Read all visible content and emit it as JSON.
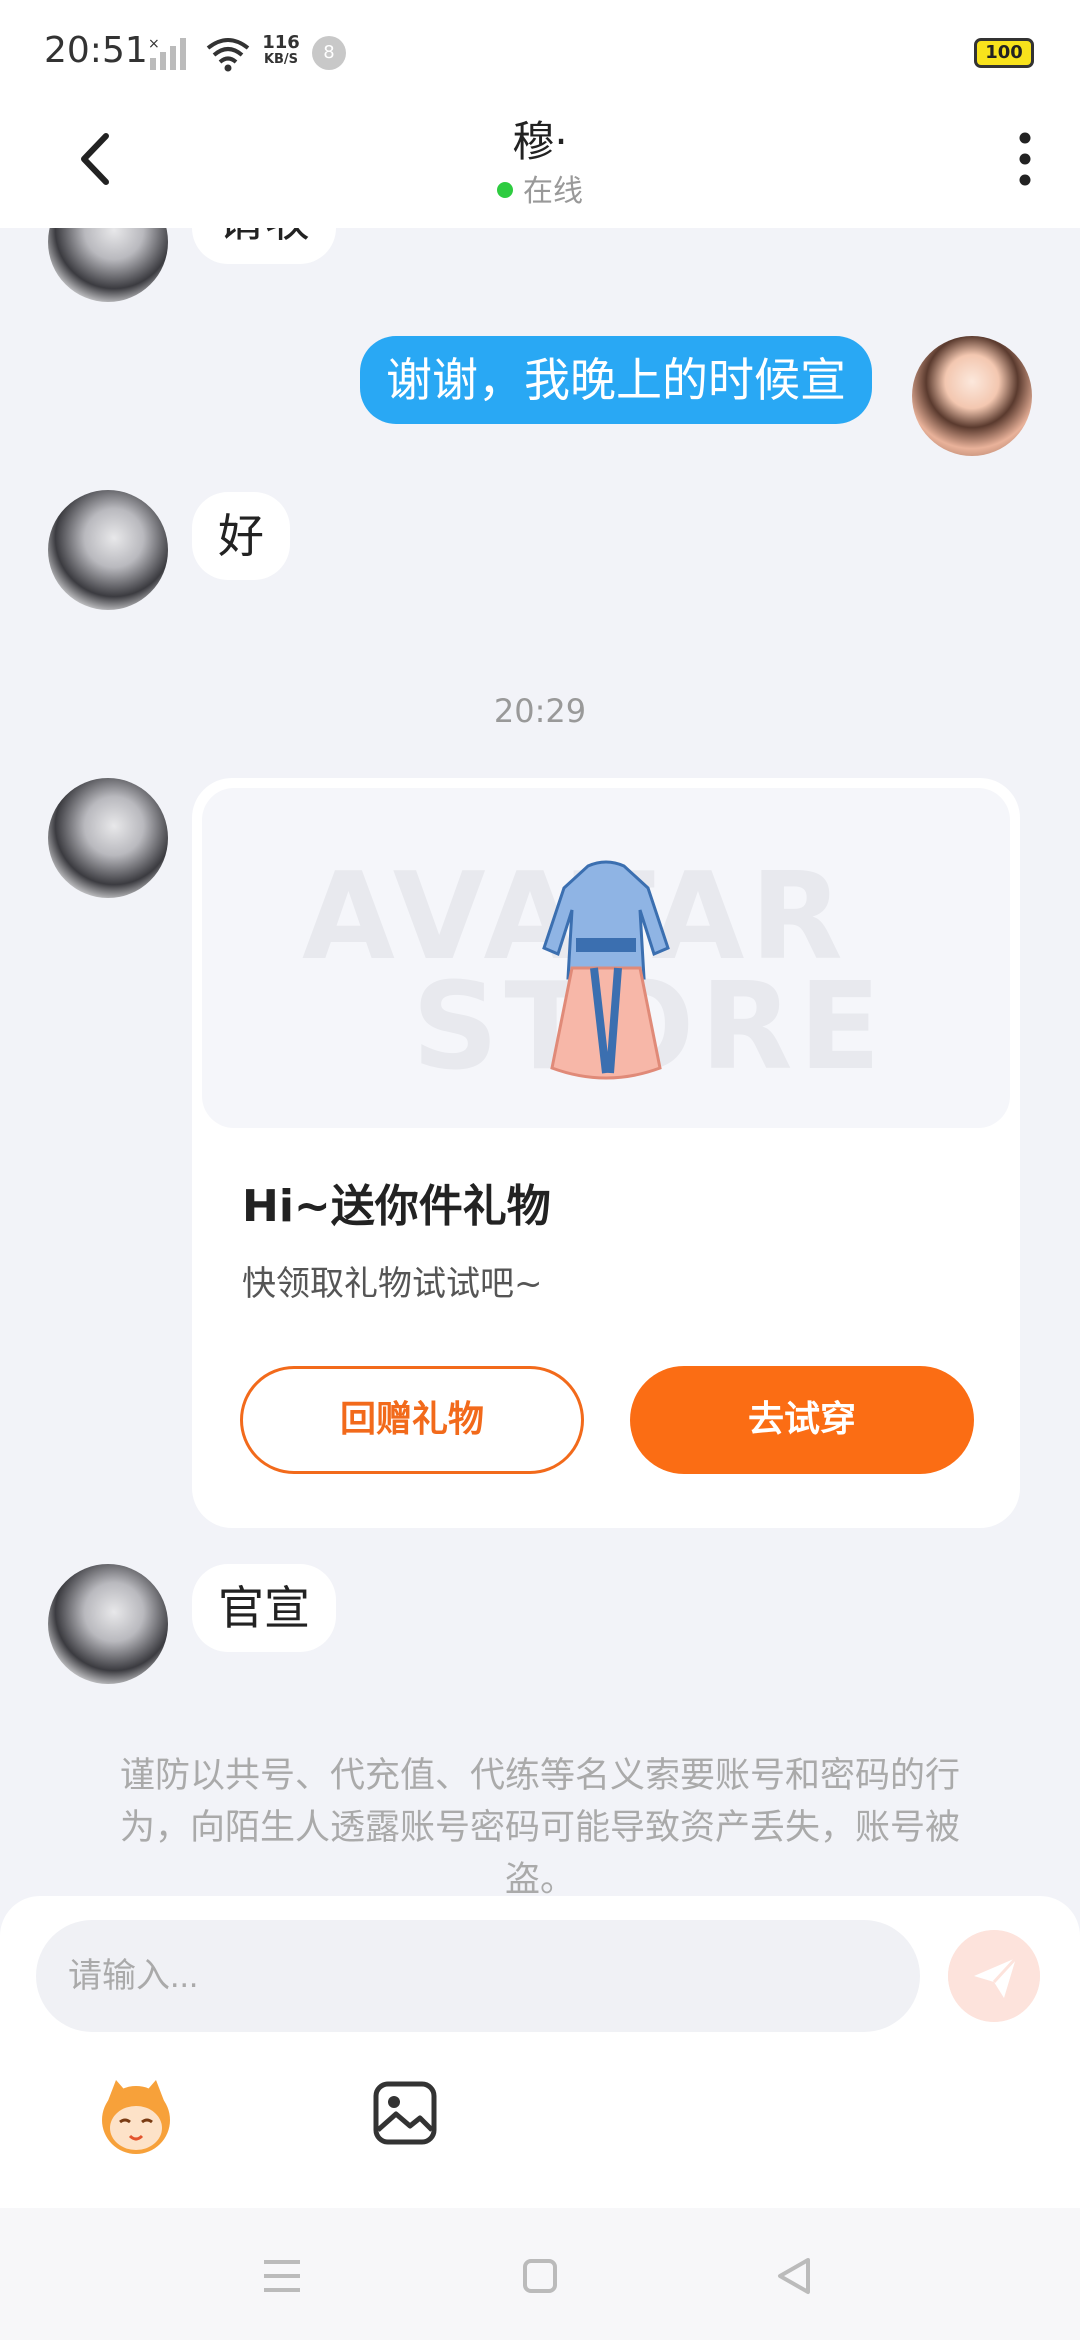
{
  "status_bar": {
    "time": "20:51",
    "net_speed_value": "116",
    "net_speed_unit": "KB/S",
    "notification_count": "8",
    "battery": "100"
  },
  "header": {
    "contact_name": "穆·",
    "presence": "在线"
  },
  "messages": {
    "partial_top": "请收",
    "me_text": "谢谢，我晚上的时候宣",
    "other_reply": "好",
    "timestamp": "20:29",
    "last_other": "官宣"
  },
  "gift_card": {
    "watermark_line1": "AVATAR",
    "watermark_line2": "STORE",
    "title": "Hi~送你件礼物",
    "subtitle": "快领取礼物试试吧~",
    "return_gift_label": "回赠礼物",
    "try_on_label": "去试穿"
  },
  "warning": "谨防以共号、代充值、代练等名义索要账号和密码的行为，向陌生人透露账号密码可能导致资产丢失，账号被盗。",
  "input": {
    "placeholder": "请输入..."
  },
  "colors": {
    "accent_orange": "#fb6d14",
    "my_bubble": "#29a8f4",
    "online_dot": "#2ecc40"
  },
  "icons": [
    "back-icon",
    "more-icon",
    "send-icon",
    "mascot-icon",
    "image-icon",
    "nav-menu-icon",
    "nav-home-icon",
    "nav-back-icon"
  ]
}
